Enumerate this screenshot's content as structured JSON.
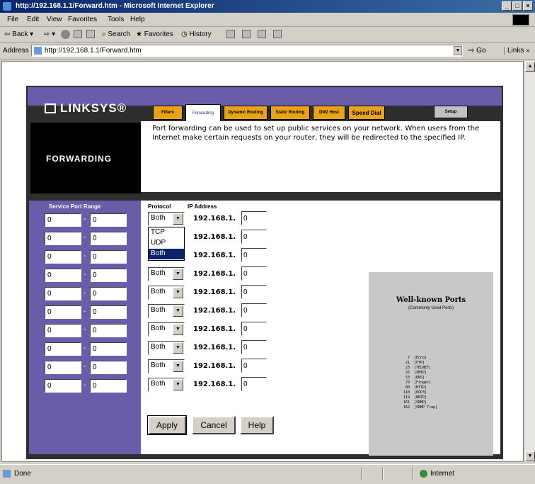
{
  "window": {
    "title": "http://192.168.1.1/Forward.htm - Microsoft Internet Explorer",
    "controls": [
      "_",
      "□",
      "×"
    ]
  },
  "menu": [
    "File",
    "Edit",
    "View",
    "Favorites",
    "Tools",
    "Help"
  ],
  "toolbar": {
    "back": "Back",
    "search": "Search",
    "favorites": "Favorites",
    "history": "History"
  },
  "address": {
    "label": "Address",
    "url": "http://192.168.1.1/Forward.htm",
    "go": "Go",
    "links": "Links »"
  },
  "linksys": {
    "logo": "LINKSYS®",
    "tabs": [
      "Filters",
      "Forwarding",
      "Dynamic Routing",
      "Static Routing",
      "DMZ Host",
      "Speed Dial"
    ],
    "active_tab": "Forwarding",
    "setup_tab": "Setup",
    "section_title": "FORWARDING",
    "description": "Port forwarding can be used to set up public services on your network. When users from the Internet make certain requests on your router, they will be redirected to the specified IP.",
    "colors": {
      "purple": "#6a5ca8",
      "tab_orange": "#e8a31a",
      "dark_bg": "#2e2e2e"
    }
  },
  "forwarding": {
    "headers": {
      "service_port_range": "Service Port Range",
      "protocol": "Protocol",
      "ip_address": "IP Address"
    },
    "ip_prefix": "192.168.1.",
    "rows": [
      {
        "start": "0",
        "end": "0",
        "protocol": "Both",
        "ip": "0"
      },
      {
        "start": "0",
        "end": "0",
        "protocol": "",
        "ip": "0"
      },
      {
        "start": "0",
        "end": "0",
        "protocol": "",
        "ip": "0"
      },
      {
        "start": "0",
        "end": "0",
        "protocol": "Both",
        "ip": "0"
      },
      {
        "start": "0",
        "end": "0",
        "protocol": "Both",
        "ip": "0"
      },
      {
        "start": "0",
        "end": "0",
        "protocol": "Both",
        "ip": "0"
      },
      {
        "start": "0",
        "end": "0",
        "protocol": "Both",
        "ip": "0"
      },
      {
        "start": "0",
        "end": "0",
        "protocol": "Both",
        "ip": "0"
      },
      {
        "start": "0",
        "end": "0",
        "protocol": "Both",
        "ip": "0"
      },
      {
        "start": "0",
        "end": "0",
        "protocol": "Both",
        "ip": "0"
      }
    ],
    "dropdown_options": [
      "TCP",
      "UDP",
      "Both"
    ],
    "dropdown_selected": "Both"
  },
  "well_known": {
    "title": "Well-known Ports",
    "subtitle": "(Commonly Used Ports)",
    "ports": [
      {
        "num": "7",
        "name": "[Echo]"
      },
      {
        "num": "21",
        "name": "[FTP]"
      },
      {
        "num": "23",
        "name": "[TELNET]"
      },
      {
        "num": "25",
        "name": "[SMTP]"
      },
      {
        "num": "53",
        "name": "[DNS]"
      },
      {
        "num": "79",
        "name": "[Finger]"
      },
      {
        "num": "80",
        "name": "[HTTP]"
      },
      {
        "num": "110",
        "name": "[POP3]"
      },
      {
        "num": "119",
        "name": "[NNTP]"
      },
      {
        "num": "161",
        "name": "[SNMP]"
      },
      {
        "num": "162",
        "name": "[SNMP Trap]"
      }
    ]
  },
  "buttons": {
    "apply": "Apply",
    "cancel": "Cancel",
    "help": "Help"
  },
  "status": {
    "text": "Done",
    "zone": "Internet"
  }
}
